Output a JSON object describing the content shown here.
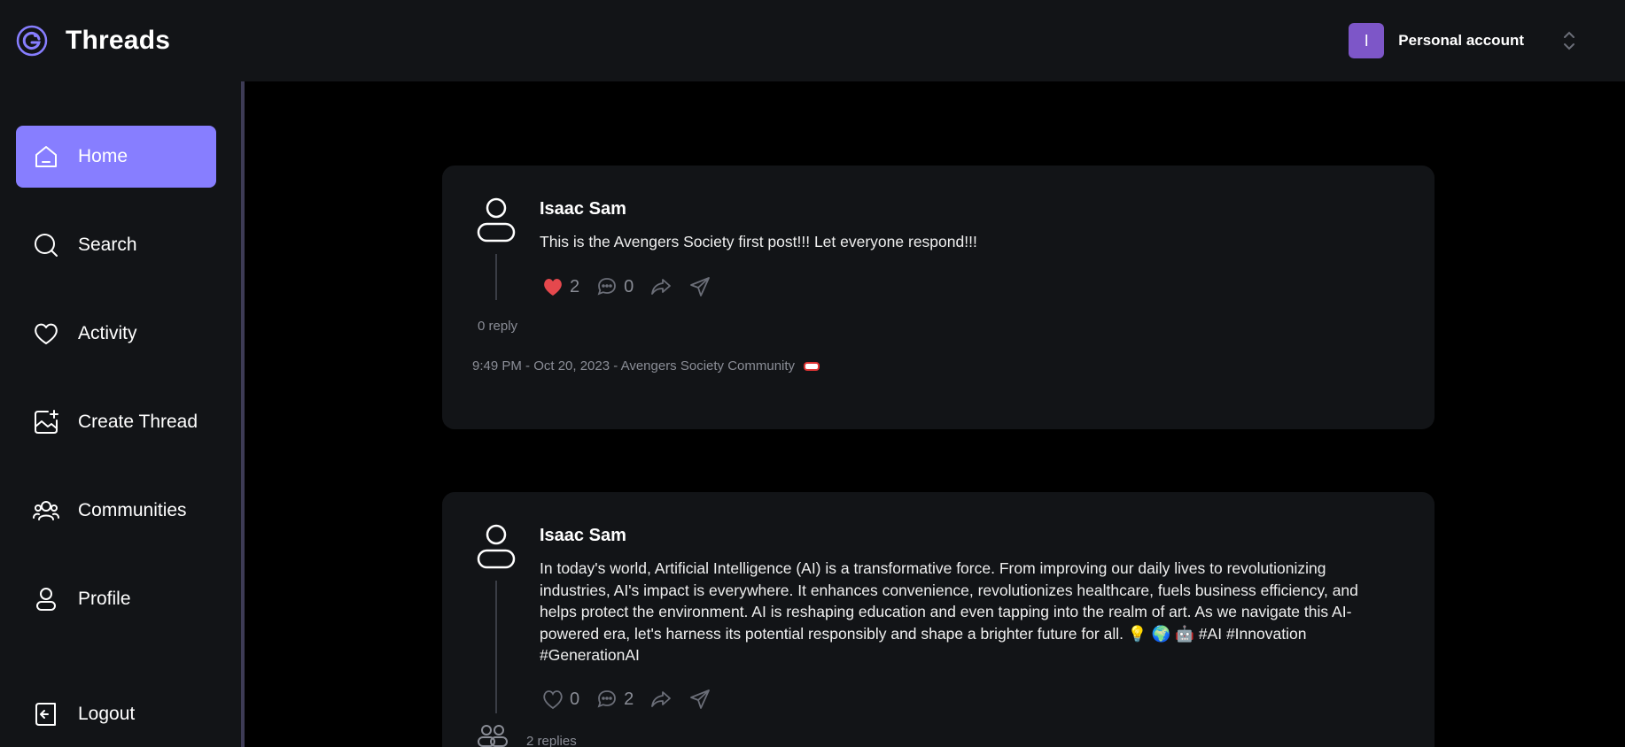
{
  "app": {
    "title": "Threads"
  },
  "account": {
    "initial": "I",
    "label": "Personal account"
  },
  "sidebar": {
    "items": [
      {
        "label": "Home",
        "icon": "home-icon",
        "active": true
      },
      {
        "label": "Search",
        "icon": "search-icon"
      },
      {
        "label": "Activity",
        "icon": "heart-icon"
      },
      {
        "label": "Create Thread",
        "icon": "create-image-icon"
      },
      {
        "label": "Communities",
        "icon": "communities-icon"
      },
      {
        "label": "Profile",
        "icon": "user-icon"
      }
    ],
    "logout_label": "Logout"
  },
  "posts": [
    {
      "author": "Isaac Sam",
      "content": "This is the Avengers Society first post!!! Let everyone respond!!!",
      "likes": "2",
      "liked": true,
      "comments": "0",
      "replies_label": "0 reply",
      "meta": "9:49 PM - Oct 20, 2023 - Avengers Society Community"
    },
    {
      "author": "Isaac Sam",
      "content": "In today's world, Artificial Intelligence (AI) is a transformative force. From improving our daily lives to revolutionizing industries, AI's impact is everywhere. It enhances convenience, revolutionizes healthcare, fuels business efficiency, and helps protect the environment. AI is reshaping education and even tapping into the realm of art. As we navigate this AI-powered era, let's harness its potential responsibly and shape a brighter future for all. 💡 🌍 🤖 #AI #Innovation #GenerationAI",
      "likes": "0",
      "liked": false,
      "comments": "2",
      "replies_label": "2 replies"
    }
  ],
  "colors": {
    "accent": "#877eff",
    "bg": "#000000",
    "panel": "#121417",
    "like": "#e5484d",
    "avatar": "#7d56c8"
  }
}
